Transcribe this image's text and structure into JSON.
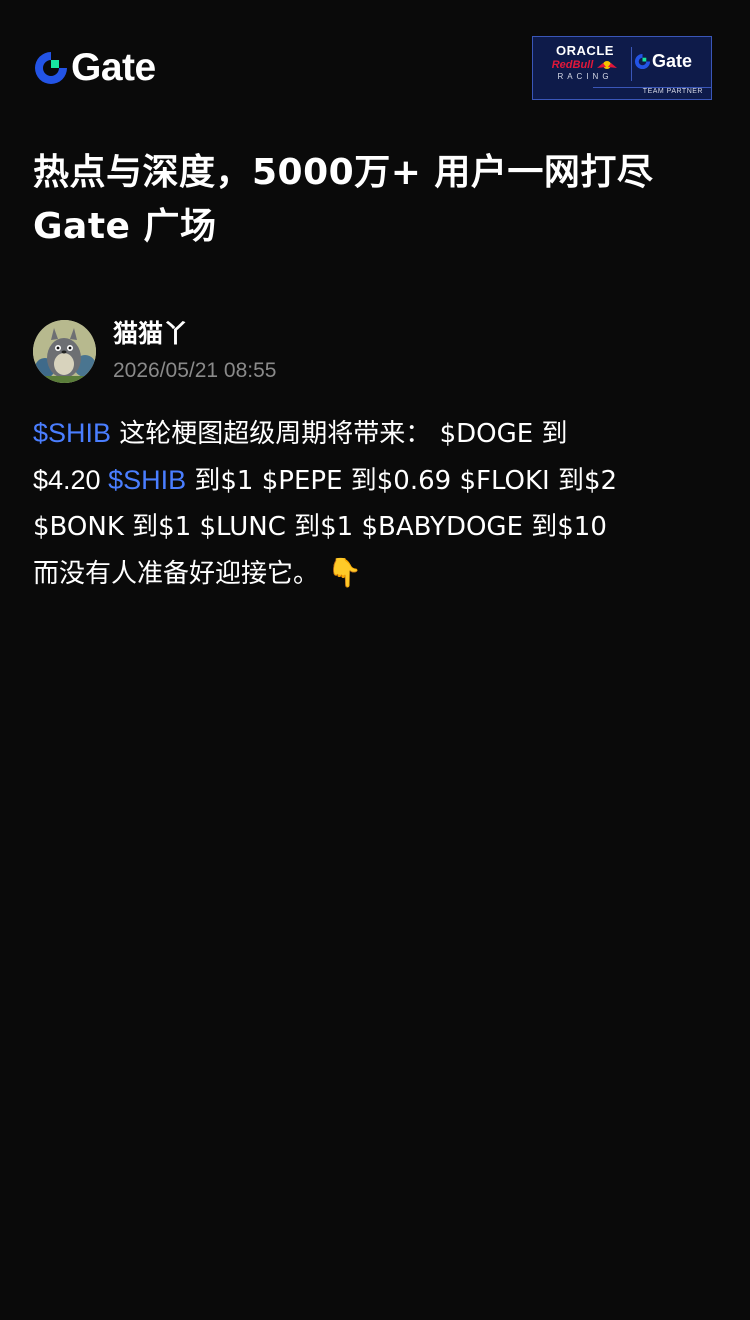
{
  "header": {
    "brand_name": "Gate",
    "partner": {
      "oracle": "ORACLE",
      "redbull": "RedBull",
      "racing": "RACING",
      "brand": "Gate",
      "team_partner": "TEAM PARTNER"
    }
  },
  "headline": {
    "line1": "热点与深度，5000万+ 用户一网打尽",
    "line2": "Gate 广场"
  },
  "post": {
    "author_name": "猫猫丫",
    "timestamp": "2026/05/21 08:55",
    "body": {
      "line1_ticker": "$SHIB",
      "line1_text": " 这轮梗图超级周期将带来：  $DOGE 到",
      "line2_prefix": "$4.20 ",
      "line2_ticker": "$SHIB",
      "line2_text": " 到$1 $PEPE 到$0.69 $FLOKI 到$2",
      "line3_text": "$BONK 到$1 $LUNC 到$1 $BABYDOGE 到$10",
      "line4_text": "而没有人准备好迎接它。",
      "emoji": "👇"
    }
  },
  "colors": {
    "background": "#0a0a0a",
    "link": "#4a7eff",
    "muted": "#8a8a8a",
    "brand_blue": "#2354e6",
    "brand_green": "#17e6a1"
  }
}
